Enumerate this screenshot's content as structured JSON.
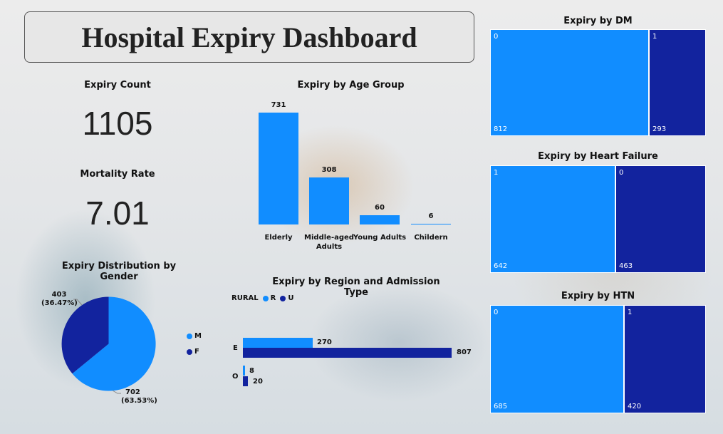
{
  "title": "Hospital Expiry Dashboard",
  "colors": {
    "light": "#118DFF",
    "dark": "#12239E"
  },
  "kpis": {
    "expiry_count_label": "Expiry Count",
    "expiry_count_value": "1105",
    "mortality_label": "Mortality Rate",
    "mortality_value": "7.01"
  },
  "age_chart": {
    "title": "Expiry by Age Group",
    "bars": [
      {
        "label": "Elderly",
        "value": "731"
      },
      {
        "label": "Middle-aged Adults",
        "value": "308"
      },
      {
        "label": "Young Adults",
        "value": "60"
      },
      {
        "label": "Childern",
        "value": "6"
      }
    ]
  },
  "gender_chart": {
    "title": "Expiry Distribution by Gender",
    "f_label": "403",
    "f_pct": "(36.47%)",
    "m_label": "702",
    "m_pct": "(63.53%)",
    "legend": [
      "M",
      "F"
    ]
  },
  "region_chart": {
    "title": "Expiry by Region and Admission Type",
    "legend_title": "RURAL",
    "legend": [
      "R",
      "U"
    ],
    "categories": [
      "E",
      "O"
    ],
    "E": {
      "R": "270",
      "U": "807"
    },
    "O": {
      "R": "8",
      "U": "20"
    }
  },
  "chart_data": [
    {
      "type": "bar",
      "title": "Expiry by Age Group",
      "categories": [
        "Elderly",
        "Middle-aged Adults",
        "Young Adults",
        "Childern"
      ],
      "values": [
        731,
        308,
        60,
        6
      ]
    },
    {
      "type": "pie",
      "title": "Expiry Distribution by Gender",
      "categories": [
        "M",
        "F"
      ],
      "values": [
        702,
        403
      ]
    },
    {
      "type": "bar",
      "title": "Expiry by Region and Admission Type",
      "categories": [
        "E",
        "O"
      ],
      "series": [
        {
          "name": "R",
          "values": [
            270,
            8
          ]
        },
        {
          "name": "U",
          "values": [
            807,
            20
          ]
        }
      ]
    },
    {
      "type": "bar",
      "title": "Expiry by DM",
      "categories": [
        "0",
        "1"
      ],
      "values": [
        812,
        293
      ]
    },
    {
      "type": "bar",
      "title": "Expiry by Heart Failure",
      "categories": [
        "1",
        "0"
      ],
      "values": [
        642,
        463
      ]
    },
    {
      "type": "bar",
      "title": "Expiry by HTN",
      "categories": [
        "0",
        "1"
      ],
      "values": [
        685,
        420
      ]
    }
  ],
  "treemaps": {
    "dm": {
      "title": "Expiry by DM",
      "a_key": "0",
      "a_val": "812",
      "b_key": "1",
      "b_val": "293"
    },
    "hf": {
      "title": "Expiry by Heart Failure",
      "a_key": "1",
      "a_val": "642",
      "b_key": "0",
      "b_val": "463"
    },
    "htn": {
      "title": "Expiry by HTN",
      "a_key": "0",
      "a_val": "685",
      "b_key": "1",
      "b_val": "420"
    }
  }
}
